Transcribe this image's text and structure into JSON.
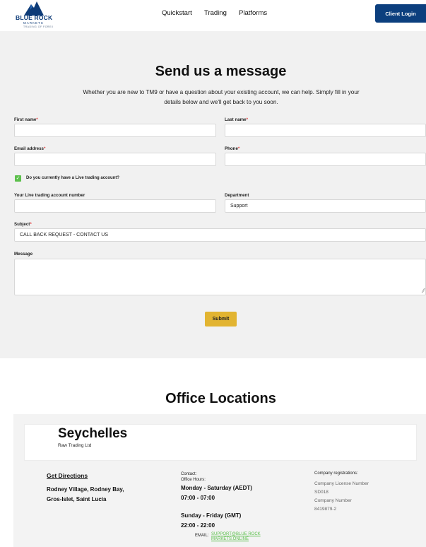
{
  "header": {
    "logo_text": "BLUE ROCK",
    "logo_sub": "MARKETS",
    "logo_tagline": "TRADING OF FOREX",
    "nav": [
      "Quickstart",
      "Trading",
      "Platforms"
    ],
    "login_label": "Client Login",
    "brand_color": "#0c3f7e"
  },
  "form": {
    "title": "Send us a message",
    "intro_line1": "Whether you are new to TM9 or have a question about your existing account, we can help. Simply fill in your",
    "intro_line2": "details below and we'll get back to you soon.",
    "first_name_label": "First name",
    "last_name_label": "Last name",
    "email_label": "Email address",
    "phone_label": "Phone",
    "required_mark": "*",
    "checkbox_label": "Do you currently have a Live trading account?",
    "checkbox_checked": true,
    "account_number_label": "Your Live trading account number",
    "department_label": "Department",
    "department_value": "Support",
    "subject_label": "Subject",
    "subject_value": "CALL BACK REQUEST - CONTACT US",
    "message_label": "Message",
    "submit_label": "Submit",
    "submit_color": "#e2b431",
    "checkbox_color": "#5dc04d"
  },
  "offices": {
    "title": "Office Locations",
    "city": "Seychelles",
    "company": "Raw Trading Ltd",
    "directions_label": "Get Directions",
    "address_line1": "Rodney Village, Rodney Bay,",
    "address_line2": "Gros-Islet, Saint Lucia",
    "contact_label": "Contact:",
    "office_hours_label": "Office Hours:",
    "hours1_days": "Monday - Saturday (AEDT)",
    "hours1_time": "07:00 - 07:00",
    "hours2_days": "Sunday - Friday (GMT)",
    "hours2_time": "22:00 - 22:00",
    "email_label": "EMAIL:",
    "email_value": "SUPPORT@BLUE ROCK MARKETS.ONLINE",
    "registrations_label": "Company registrations:",
    "license_label": "Company License Number",
    "license_value": "SD018",
    "company_number_label": "Company Number",
    "company_number_value": "8419879-2"
  }
}
